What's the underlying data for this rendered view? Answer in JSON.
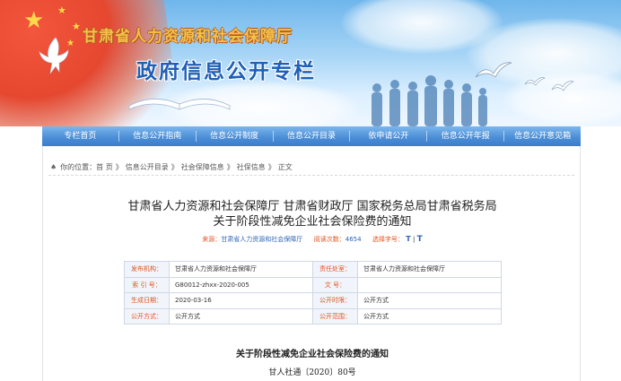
{
  "header": {
    "dept_name": "甘肃省人力资源和社会保障厅",
    "section_title": "政府信息公开专栏"
  },
  "nav": {
    "items": [
      "专栏首页",
      "信息公开指南",
      "信息公开制度",
      "信息公开目录",
      "依申请公开",
      "信息公开年报",
      "信息公开意见箱"
    ]
  },
  "breadcrumb": {
    "label": "你的位置：",
    "items": [
      "首 页",
      "信息公开目录",
      "社会保障信息",
      "社保信息",
      "正文"
    ],
    "separator": "》"
  },
  "article": {
    "title_line1": "甘肃省人力资源和社会保障厅  甘肃省财政厅  国家税务总局甘肃省税务局",
    "title_line2": "关于阶段性减免企业社会保险费的通知",
    "source_label": "来源：",
    "source_value": "甘肃省人力资源和社会保障厅",
    "views_label": "阅读次数：",
    "views_value": "4654",
    "font_label": "选择字号：",
    "font_large": "T",
    "font_sep": "|",
    "font_small": "T"
  },
  "info_table": {
    "rows": [
      [
        {
          "k": "发布机构：",
          "v": "甘肃省人力资源和社会保障厅"
        },
        {
          "k": "责任处室：",
          "v": "甘肃省人力资源和社会保障厅"
        }
      ],
      [
        {
          "k": "索  引  号：",
          "v": "G80012-zhxx-2020-005"
        },
        {
          "k": "文   号：",
          "v": ""
        }
      ],
      [
        {
          "k": "生成日期：",
          "v": "2020-03-16"
        },
        {
          "k": "公开时限：",
          "v": "公开方式"
        }
      ],
      [
        {
          "k": "公开方式：",
          "v": "公开方式"
        },
        {
          "k": "公开范围：",
          "v": "公开方式"
        }
      ]
    ]
  },
  "body": {
    "heading": "关于阶段性减免企业社会保险费的通知",
    "doc_number": "甘人社通〔2020〕80号"
  },
  "colors": {
    "nav_blue": "#4d8fd6",
    "label_orange": "#e0531f",
    "link_blue": "#2f63b5",
    "title_gold": "#f3c24a",
    "section_blue": "#1f5fb6"
  }
}
